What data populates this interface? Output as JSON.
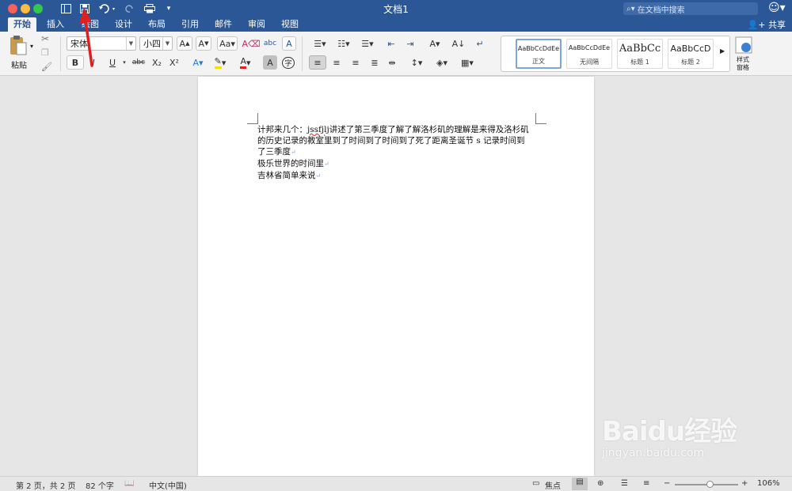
{
  "window": {
    "title": "文档1"
  },
  "search": {
    "placeholder": "在文档中搜索",
    "icon": "search-icon"
  },
  "tabs": [
    "开始",
    "插入",
    "绘图",
    "设计",
    "布局",
    "引用",
    "邮件",
    "审阅",
    "视图"
  ],
  "share_label": "共享",
  "clipboard": {
    "paste_label": "粘贴"
  },
  "font": {
    "name": "宋体",
    "size": "小四"
  },
  "format_buttons": {
    "bold": "B",
    "italic": "I",
    "underline": "U",
    "strike": "abc",
    "subscript": "X₂",
    "superscript": "X²",
    "clear": "A",
    "phonetic": "字"
  },
  "styles": [
    {
      "sample": "AaBbCcDdEe",
      "name": "正文"
    },
    {
      "sample": "AaBbCcDdEe",
      "name": "无间隔"
    },
    {
      "sample": "AaBbCc",
      "name": "标题 1"
    },
    {
      "sample": "AaBbCcD",
      "name": "标题 2"
    }
  ],
  "styles_pane_label": "样式\n窗格",
  "document": {
    "paragraph1_before": "计邦来几个：",
    "paragraph1_typo": "jssfjlj",
    "paragraph1_after": "讲述了第三季度了解了解洛杉矶的理解是来得及洛杉矶的历史记录的教室里到了时间到了时间到了死了距离圣诞节 s 记录时间到了三季度",
    "paragraph2": "极乐世界的时间里",
    "paragraph3": "吉林省简单来说"
  },
  "status": {
    "page": "第 2 页，共 2 页",
    "words": "82 个字",
    "language": "中文(中国)",
    "focus": "焦点",
    "zoom": "106%",
    "zoom_fraction": 0.55
  },
  "watermark": {
    "logo": "Baidu经验",
    "url": "jingyan.baidu.com"
  },
  "colors": {
    "titlebar": "#2b5797",
    "annotation_arrow": "#e02020"
  }
}
